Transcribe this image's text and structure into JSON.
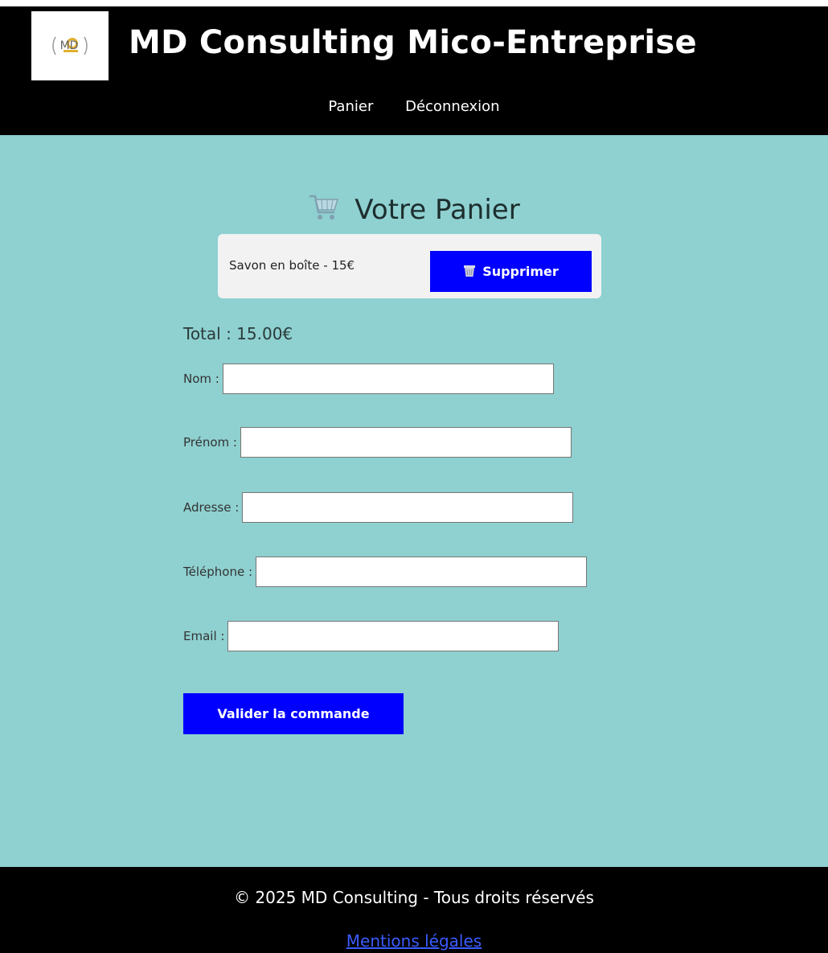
{
  "header": {
    "logo_text": "MD",
    "title": "MD Consulting Mico-Entreprise",
    "nav": [
      {
        "label": "Panier"
      },
      {
        "label": "Déconnexion"
      }
    ]
  },
  "cart": {
    "title": "Votre Panier",
    "items": [
      {
        "label": "Savon en boîte - 15€",
        "delete_label": "Supprimer"
      }
    ],
    "total": "Total : 15.00€"
  },
  "form": {
    "fields": [
      {
        "label": "Nom :",
        "value": ""
      },
      {
        "label": "Prénom :",
        "value": ""
      },
      {
        "label": "Adresse :",
        "value": ""
      },
      {
        "label": "Téléphone :",
        "value": ""
      },
      {
        "label": "Email :",
        "value": ""
      }
    ],
    "submit_label": "Valider la commande"
  },
  "footer": {
    "copyright": "© 2025 MD Consulting - Tous droits réservés",
    "legal_link": "Mentions légales"
  },
  "colors": {
    "header_bg": "#000000",
    "main_bg": "#8fd0d0",
    "button_bg": "#0000ff",
    "logo_accent": "#e0b030"
  }
}
